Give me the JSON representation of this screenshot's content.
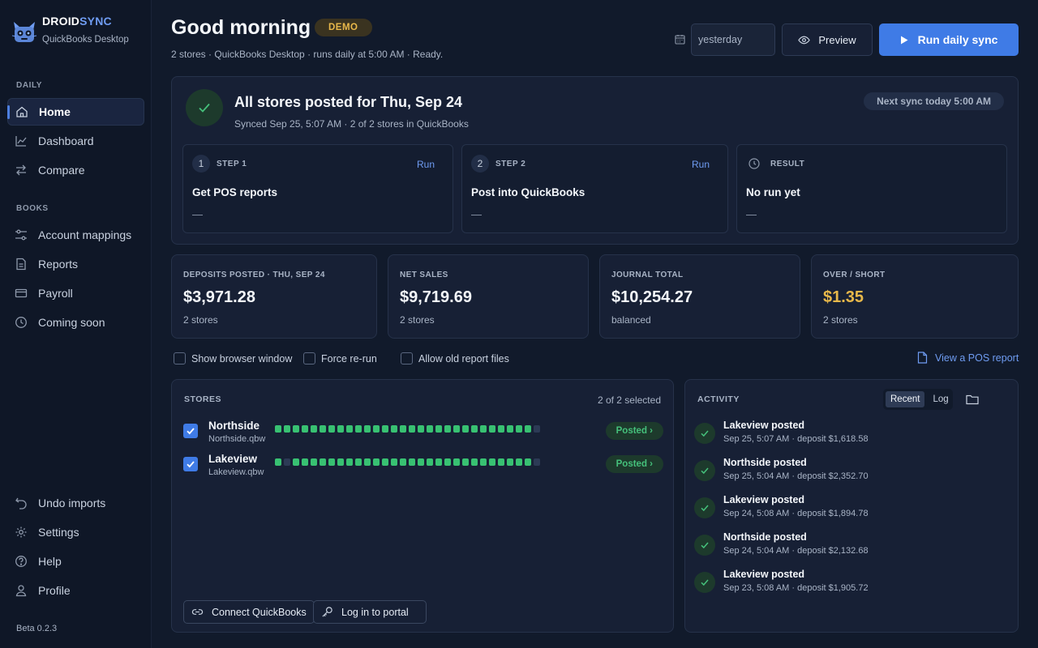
{
  "sidebar": {
    "brand_part1": "DROID",
    "brand_part2": "SYNC",
    "brand_sub": "QuickBooks Desktop",
    "section_daily": "DAILY",
    "section_books": "BOOKS",
    "items": [
      {
        "label": "Home",
        "icon": "home-icon"
      },
      {
        "label": "Dashboard",
        "icon": "chart-icon"
      },
      {
        "label": "Compare",
        "icon": "compare-arrows-icon"
      },
      {
        "label": "Account mappings",
        "icon": "sliders-icon"
      },
      {
        "label": "Reports",
        "icon": "document-icon"
      },
      {
        "label": "Payroll",
        "icon": "card-icon"
      },
      {
        "label": "Coming soon",
        "icon": "clock-icon"
      },
      {
        "label": "Undo imports",
        "icon": "undo-icon"
      },
      {
        "label": "Settings",
        "icon": "gear-icon"
      },
      {
        "label": "Help",
        "icon": "help-icon"
      },
      {
        "label": "Profile",
        "icon": "user-icon"
      }
    ],
    "version": "Beta 0.2.3"
  },
  "header": {
    "greeting": "Good morning",
    "badge": "DEMO",
    "subline": "2 stores · QuickBooks Desktop · runs daily at 5:00 AM · Ready.",
    "date_value": "yesterday",
    "preview_label": "Preview",
    "run_label": "Run daily sync",
    "accent_color": "#3f7be6"
  },
  "status": {
    "title": "All stores posted for Thu, Sep 24",
    "sub": "Synced Sep 25, 5:07 AM · 2 of 2 stores in QuickBooks",
    "next_sync": "Next sync today 5:00 AM",
    "steps": [
      {
        "num": "1",
        "label": "STEP 1",
        "action": "Run",
        "title": "Get POS reports",
        "detail": "—"
      },
      {
        "num": "2",
        "label": "STEP 2",
        "action": "Run",
        "title": "Post into QuickBooks",
        "detail": "—"
      },
      {
        "label": "RESULT",
        "title": "No run yet",
        "detail": "—"
      }
    ]
  },
  "metrics": [
    {
      "label": "DEPOSITS POSTED · THU, SEP 24",
      "value": "$3,971.28",
      "sub": "2 stores"
    },
    {
      "label": "NET SALES",
      "value": "$9,719.69",
      "sub": "2 stores"
    },
    {
      "label": "JOURNAL TOTAL",
      "value": "$10,254.27",
      "sub": "balanced"
    },
    {
      "label": "OVER / SHORT",
      "value": "$1.35",
      "sub": "2 stores",
      "color": "#e8b84a"
    }
  ],
  "options": {
    "show_browser": "Show browser window",
    "force_rerun": "Force re-run",
    "allow_old": "Allow old report files",
    "pos_link": "View a POS report"
  },
  "stores": {
    "title": "STORES",
    "selected": "2 of 2 selected",
    "rows": [
      {
        "name": "Northside",
        "file": "Northside.qbw",
        "status": "Posted ›",
        "history": [
          1,
          1,
          1,
          1,
          1,
          1,
          1,
          1,
          1,
          1,
          1,
          1,
          1,
          1,
          1,
          1,
          1,
          1,
          1,
          1,
          1,
          1,
          1,
          1,
          1,
          1,
          1,
          1,
          1,
          0
        ]
      },
      {
        "name": "Lakeview",
        "file": "Lakeview.qbw",
        "status": "Posted ›",
        "history": [
          1,
          0,
          1,
          1,
          1,
          1,
          1,
          1,
          1,
          1,
          1,
          1,
          1,
          1,
          1,
          1,
          1,
          1,
          1,
          1,
          1,
          1,
          1,
          1,
          1,
          1,
          1,
          1,
          1,
          0
        ]
      }
    ],
    "connect_label": "Connect QuickBooks",
    "portal_label": "Log in to portal"
  },
  "activity": {
    "title": "ACTIVITY",
    "tab_recent": "Recent",
    "tab_log": "Log",
    "items": [
      {
        "title": "Lakeview posted",
        "meta": "Sep 25, 5:07 AM · deposit $1,618.58"
      },
      {
        "title": "Northside posted",
        "meta": "Sep 25, 5:04 AM · deposit $2,352.70"
      },
      {
        "title": "Lakeview posted",
        "meta": "Sep 24, 5:08 AM · deposit $1,894.78"
      },
      {
        "title": "Northside posted",
        "meta": "Sep 24, 5:04 AM · deposit $2,132.68"
      },
      {
        "title": "Lakeview posted",
        "meta": "Sep 23, 5:08 AM · deposit $1,905.72"
      }
    ]
  }
}
